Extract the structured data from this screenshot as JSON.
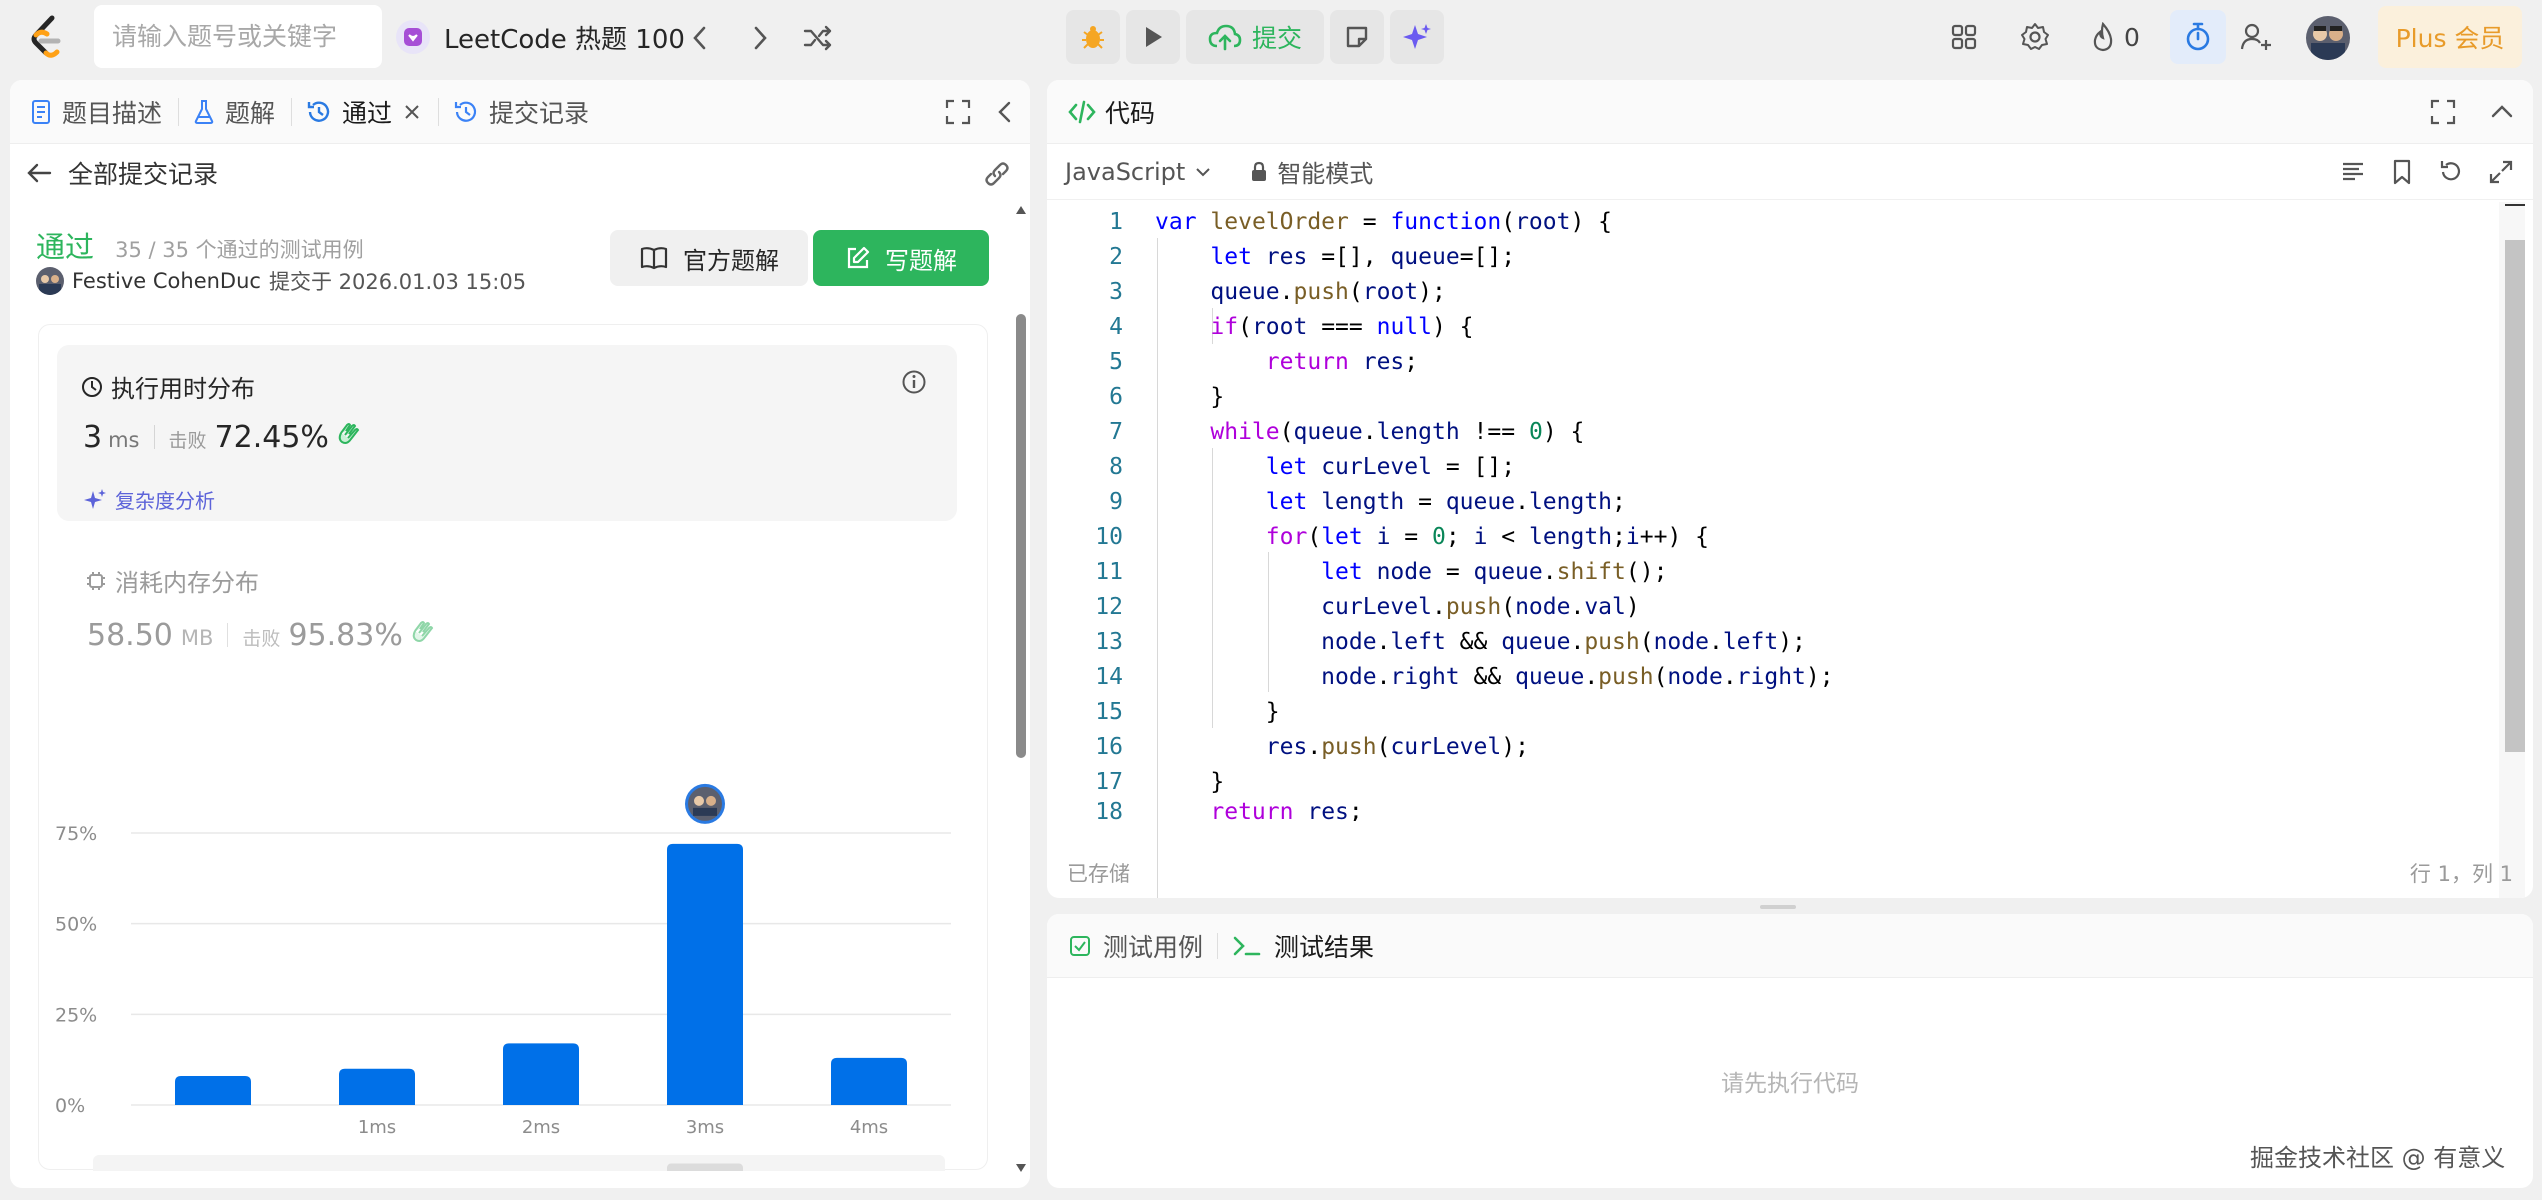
{
  "topbar": {
    "search_placeholder": "请输入题号或关键字",
    "problem_list": "LeetCode 热题 100",
    "submit_label": "提交",
    "streak_count": "0",
    "plus_label": "Plus 会员"
  },
  "left": {
    "tabs": [
      {
        "label": "题目描述"
      },
      {
        "label": "题解"
      },
      {
        "label": "通过"
      },
      {
        "label": "提交记录"
      }
    ],
    "back_label": "全部提交记录",
    "status": "通过",
    "passed_cases": "35 / 35 个通过的测试用例",
    "username": "Festive CohenDuc",
    "submitted_at": "提交于 2026.01.03 15:05",
    "official_solution": "官方题解",
    "write_solution": "写题解",
    "runtime": {
      "title": "执行用时分布",
      "value": "3",
      "unit": "ms",
      "beat_label": "击败",
      "beat_pct": "72.45%",
      "complexity": "复杂度分析"
    },
    "memory": {
      "title": "消耗内存分布",
      "value": "58.50",
      "unit": "MB",
      "beat_label": "击败",
      "beat_pct": "95.83%"
    }
  },
  "chart_data": {
    "type": "bar",
    "categories": [
      "",
      "1ms",
      "2ms",
      "3ms",
      "4ms"
    ],
    "values": [
      8,
      10,
      17,
      72,
      13
    ],
    "yticks": [
      "75%",
      "50%",
      "25%",
      "0%"
    ],
    "ylim": [
      0,
      75
    ],
    "highlight": "3ms",
    "bar_color": "#0070e8",
    "xlabel": "",
    "ylabel": "",
    "title": "",
    "minimap_labels": [
      "1ms",
      "2ms",
      "3ms",
      "4ms"
    ]
  },
  "code": {
    "title": "代码",
    "language": "JavaScript",
    "mode": "智能模式",
    "saved": "已存储",
    "cursor": "行 1，列 1",
    "lines": [
      {
        "n": "1"
      },
      {
        "n": "2"
      },
      {
        "n": "3"
      },
      {
        "n": "4"
      },
      {
        "n": "5"
      },
      {
        "n": "6"
      },
      {
        "n": "7"
      },
      {
        "n": "8"
      },
      {
        "n": "9"
      },
      {
        "n": "10"
      },
      {
        "n": "11"
      },
      {
        "n": "12"
      },
      {
        "n": "13"
      },
      {
        "n": "14"
      },
      {
        "n": "15"
      },
      {
        "n": "16"
      },
      {
        "n": "17"
      },
      {
        "n": "18"
      }
    ]
  },
  "tests": {
    "tab_cases": "测试用例",
    "tab_results": "测试结果",
    "hint": "请先执行代码"
  },
  "watermark": "掘金技术社区 @ 有意义",
  "colors": {
    "green": "#2db55d",
    "blue": "#0070e8",
    "plus": "#e89b2a"
  }
}
